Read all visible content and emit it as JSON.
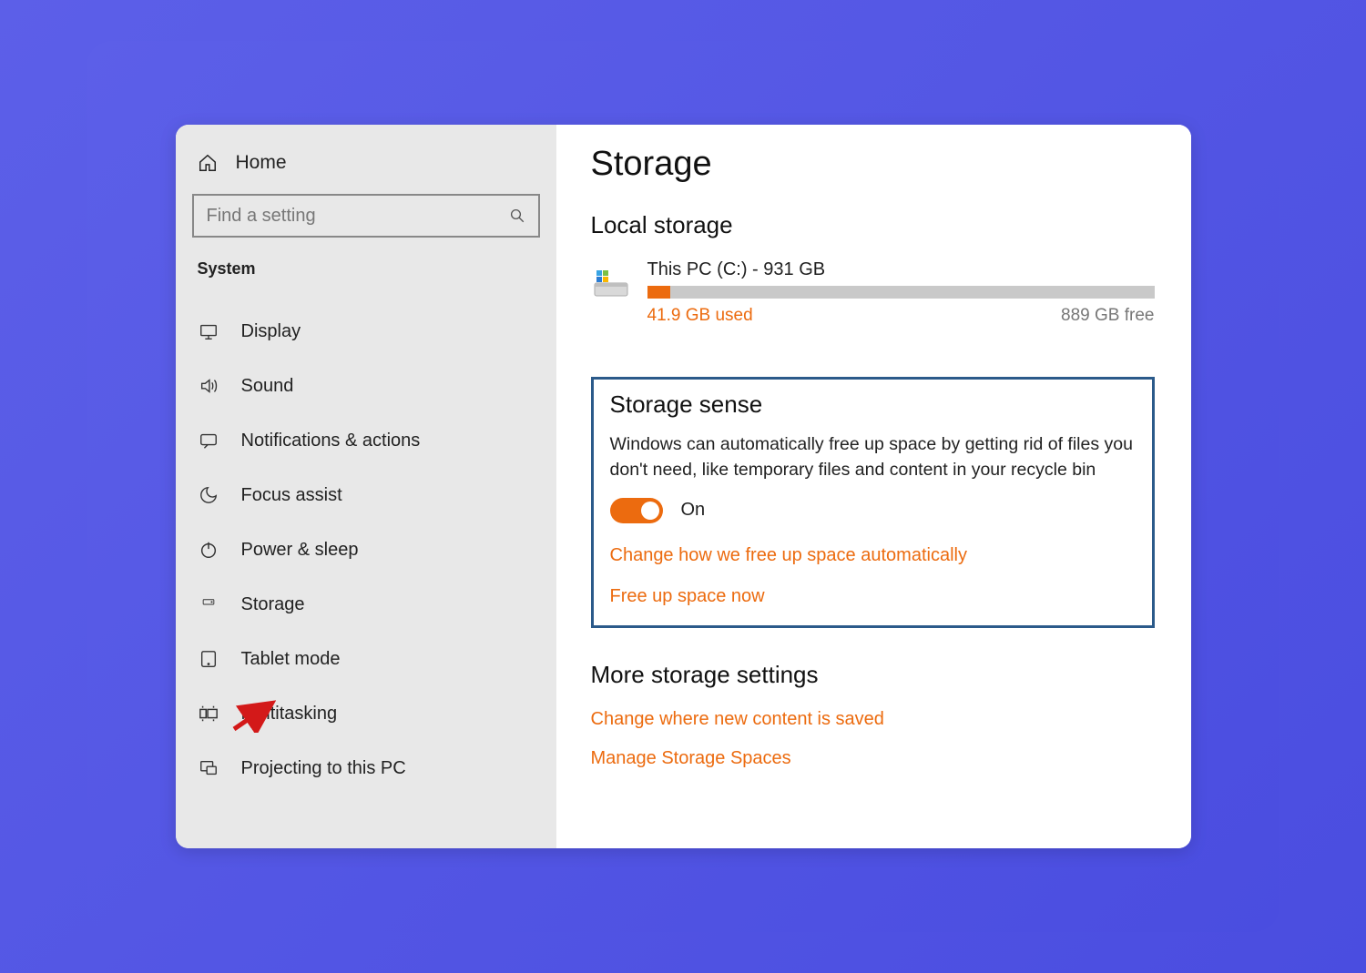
{
  "sidebar": {
    "home_label": "Home",
    "search_placeholder": "Find a setting",
    "section_label": "System",
    "items": [
      {
        "label": "Display"
      },
      {
        "label": "Sound"
      },
      {
        "label": "Notifications & actions"
      },
      {
        "label": "Focus assist"
      },
      {
        "label": "Power & sleep"
      },
      {
        "label": "Storage"
      },
      {
        "label": "Tablet mode"
      },
      {
        "label": "Multitasking"
      },
      {
        "label": "Projecting to this PC"
      }
    ]
  },
  "main": {
    "title": "Storage",
    "local_storage_heading": "Local storage",
    "drive": {
      "name": "This PC (C:) - 931 GB",
      "used_label": "41.9 GB used",
      "free_label": "889 GB free",
      "used_percent": 4.5
    },
    "storage_sense": {
      "heading": "Storage sense",
      "description": "Windows can automatically free up space by getting rid of files you don't need, like temporary files and content in your recycle bin",
      "toggle_state": "On",
      "change_link": "Change how we free up space automatically",
      "free_now_link": "Free up space now"
    },
    "more_settings": {
      "heading": "More storage settings",
      "change_save_link": "Change where new content is saved",
      "manage_spaces_link": "Manage Storage Spaces"
    }
  },
  "colors": {
    "accent_orange": "#ec6b0f",
    "box_border": "#2b5a8a"
  }
}
